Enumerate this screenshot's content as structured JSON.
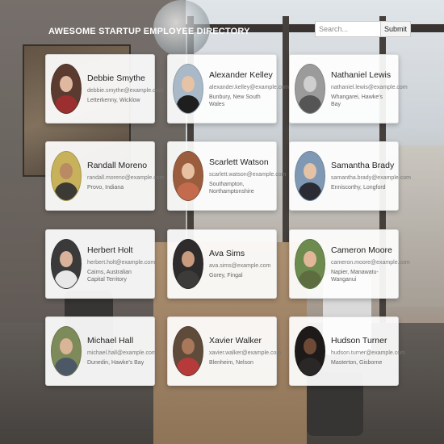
{
  "header": {
    "title": "AWESOME STARTUP EMPLOYEE DIRECTORY"
  },
  "search": {
    "placeholder": "Search...",
    "submit_label": "Submit"
  },
  "employees": [
    {
      "name": "Debbie Smythe",
      "email": "debbie.smythe@example.com",
      "location": "Letterkenny, Wicklow",
      "avatar_color": "#5b3b2f",
      "skin": "#e0b8a0",
      "shirt": "#9b2f2f"
    },
    {
      "name": "Alexander Kelley",
      "email": "alexander.kelley@example.com",
      "location": "Bunbury, New South Wales",
      "avatar_color": "#a9b9c8",
      "skin": "#e6c3a5",
      "shirt": "#1e1e1e"
    },
    {
      "name": "Nathaniel Lewis",
      "email": "nathaniel.lewis@example.com",
      "location": "Whangarei, Hawke's Bay",
      "avatar_color": "#9b9b9b",
      "skin": "#cfcfcf",
      "shirt": "#555555"
    },
    {
      "name": "Randall Moreno",
      "email": "randall.moreno@example.com",
      "location": "Provo, Indiana",
      "avatar_color": "#c7b15a",
      "skin": "#b98a63",
      "shirt": "#3c3a34"
    },
    {
      "name": "Scarlett Watson",
      "email": "scarlett.watson@example.com",
      "location": "Southampton, Northamptonshire",
      "avatar_color": "#9a5e3e",
      "skin": "#e8c0a2",
      "shirt": "#c46b4e"
    },
    {
      "name": "Samantha Brady",
      "email": "samantha.brady@example.com",
      "location": "Enniscorthy, Longford",
      "avatar_color": "#7f99b5",
      "skin": "#e4c2a6",
      "shirt": "#2b2b33"
    },
    {
      "name": "Herbert Holt",
      "email": "herbert.holt@example.com",
      "location": "Cairns, Australian Capital Territory",
      "avatar_color": "#3a3a3a",
      "skin": "#d8b29a",
      "shirt": "#e8e8e8"
    },
    {
      "name": "Ava Sims",
      "email": "ava.sims@example.com",
      "location": "Gorey, Fingal",
      "avatar_color": "#2d2b2b",
      "skin": "#c89a7e",
      "shirt": "#3d3a3a"
    },
    {
      "name": "Cameron Moore",
      "email": "cameron.moore@example.com",
      "location": "Napier, Manawatu-Wanganui",
      "avatar_color": "#6d8a4f",
      "skin": "#e2b799",
      "shirt": "#5e6d3f"
    },
    {
      "name": "Michael Hall",
      "email": "michael.hall@example.com",
      "location": "Dunedin, Hawke's Bay",
      "avatar_color": "#7d8a5a",
      "skin": "#d9b497",
      "shirt": "#4c5866"
    },
    {
      "name": "Xavier Walker",
      "email": "xavier.walker@example.com",
      "location": "Blenheim, Nelson",
      "avatar_color": "#5e4b3a",
      "skin": "#a9775a",
      "shirt": "#b63a3a"
    },
    {
      "name": "Hudson Turner",
      "email": "hudson.turner@example.com",
      "location": "Masterton, Gisborne",
      "avatar_color": "#1d1a19",
      "skin": "#6e4a36",
      "shirt": "#2a2727"
    }
  ]
}
